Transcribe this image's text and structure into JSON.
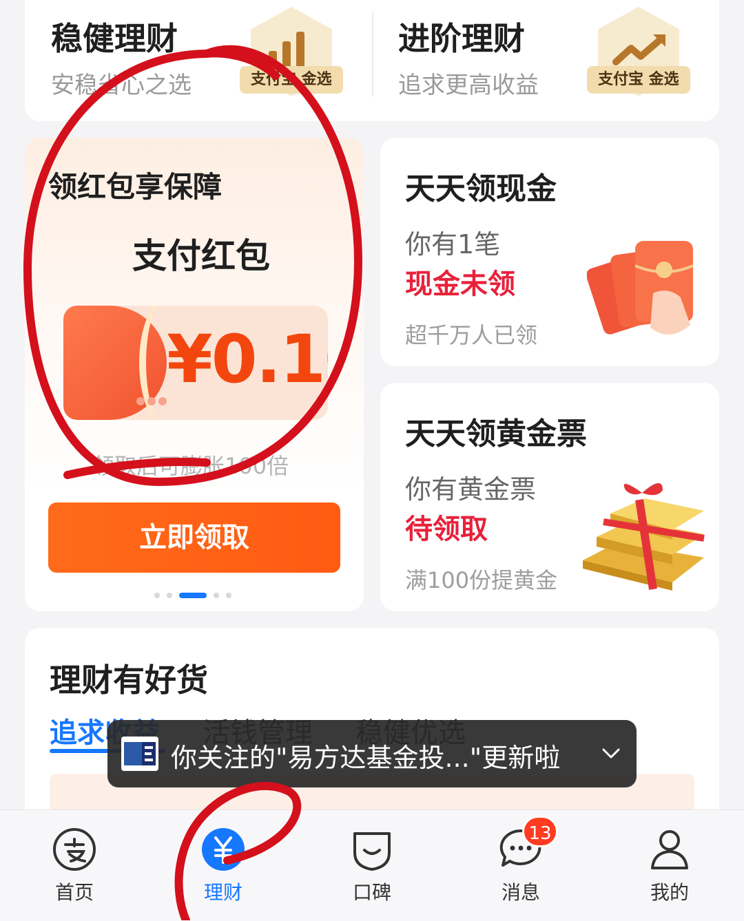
{
  "top_section": {
    "left": {
      "title": "稳健理财",
      "subtitle": "安稳省心之选",
      "badge": "支付宝 金选"
    },
    "right": {
      "title": "进阶理财",
      "subtitle": "追求更高收益",
      "badge": "支付宝 金选"
    }
  },
  "promo_card": {
    "heading": "领红包享保障",
    "title": "支付红包",
    "amount": "¥0.10",
    "note": "领取后可膨胀100倍",
    "button": "立即领取",
    "pager_active_index": 2,
    "pager_count": 5
  },
  "cash_card": {
    "title": "天天领现金",
    "line1": "你有1笔",
    "highlight": "现金未领",
    "footer": "超千万人已领"
  },
  "gold_card": {
    "title": "天天领黄金票",
    "line1": "你有黄金票",
    "highlight": "待领取",
    "footer": "满100份提黄金"
  },
  "products": {
    "title": "理财有好货",
    "tabs": [
      "追求收益",
      "活钱管理",
      "稳健优选"
    ],
    "active_tab": 0
  },
  "toast": {
    "text": "你关注的\"易方达基金投...\"更新啦"
  },
  "tabbar": {
    "items": [
      {
        "label": "首页",
        "icon": "alipay-home-icon"
      },
      {
        "label": "理财",
        "icon": "yuan-wealth-icon",
        "active": true
      },
      {
        "label": "口碑",
        "icon": "koubei-bag-icon"
      },
      {
        "label": "消息",
        "icon": "chat-bubble-icon",
        "badge": "13"
      },
      {
        "label": "我的",
        "icon": "person-icon"
      }
    ]
  },
  "colors": {
    "accent": "#1677ff",
    "promo_orange": "#ff5b12",
    "highlight_red": "#e8213a",
    "annotation_red": "#d4101c"
  }
}
